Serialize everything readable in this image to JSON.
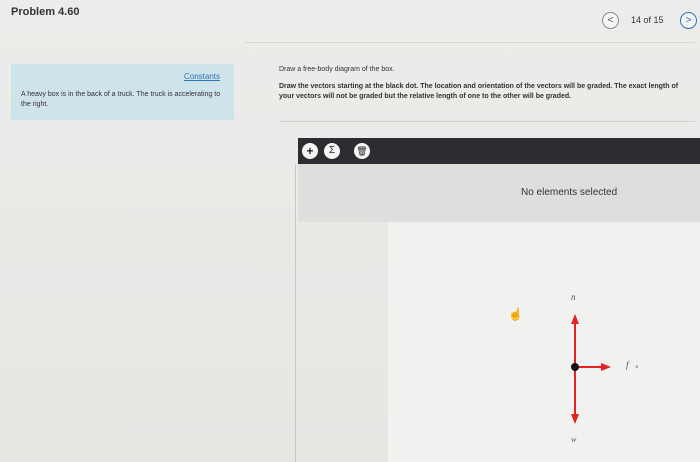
{
  "header": {
    "title": "Problem 4.60",
    "counter": "14 of 15",
    "prev_symbol": "<",
    "next_symbol": ">"
  },
  "left_panel": {
    "constants_link": "Constants",
    "problem_text": "A heavy box is in the back of a truck. The truck is accelerating to the right."
  },
  "prompt": {
    "line1": "Draw a free-body diagram of the box.",
    "line2": "Draw the vectors starting at the black dot. The location and orientation of the vectors will be graded. The exact length of your vectors will not be graded but the relative length of one to the other will be graded."
  },
  "toolbar": {
    "add_symbol": "+",
    "sum_symbol": "Σ",
    "trash_symbol": "🗑"
  },
  "status": {
    "text": "No elements selected"
  },
  "vectors": {
    "n_label": "n⃗",
    "fs_label": "f⃗ₛ",
    "w_label": "w⃗",
    "color": "#e52222"
  },
  "icons": {
    "cursor": "pointer-hand-icon",
    "trash": "trash-icon",
    "add": "plus-icon",
    "sum": "sigma-icon"
  }
}
